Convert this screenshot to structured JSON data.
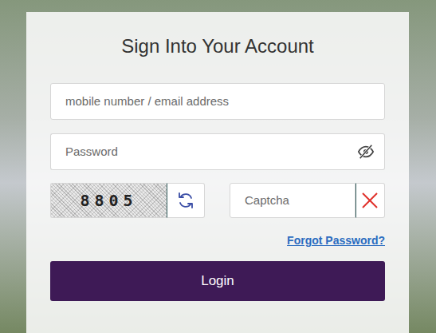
{
  "title": "Sign Into Your Account",
  "username": {
    "placeholder": "mobile number / email address"
  },
  "password": {
    "placeholder": "Password",
    "visible": false
  },
  "captcha": {
    "code": "8805",
    "placeholder": "Captcha"
  },
  "forgot_password": "Forgot Password?",
  "login_button": "Login"
}
